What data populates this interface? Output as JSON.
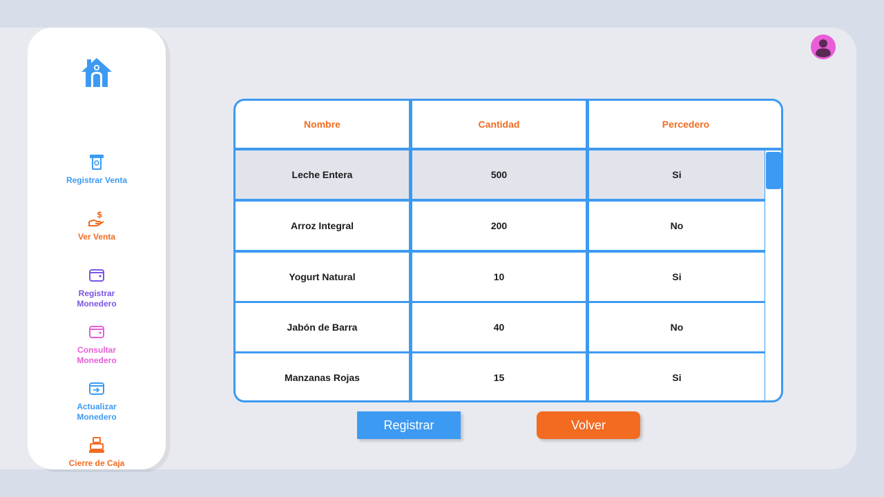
{
  "sidebar": {
    "items": [
      {
        "label": "Registrar Venta",
        "icon": "atm-cash-icon",
        "color": "#3d9af2"
      },
      {
        "label": "Ver Venta",
        "icon": "hand-money-icon",
        "color": "#f26b21"
      },
      {
        "label": "Registrar\nMonedero",
        "icon": "wallet-icon",
        "color": "#7b55e3"
      },
      {
        "label": "Consultar\nMonedero",
        "icon": "wallet-icon",
        "color": "#e85ed8"
      },
      {
        "label": "Actualizar\nMonedero",
        "icon": "wallet-transfer-icon",
        "color": "#3d9af2"
      },
      {
        "label": "Cierre de Caja",
        "icon": "cash-register-icon",
        "color": "#f26b21"
      }
    ]
  },
  "table": {
    "columns": [
      "Nombre",
      "Cantidad",
      "Percedero"
    ],
    "rows": [
      [
        "Leche Entera",
        "500",
        "Si"
      ],
      [
        "Arroz Integral",
        "200",
        "No"
      ],
      [
        "Yogurt Natural",
        "10",
        "Si"
      ],
      [
        "Jabón de Barra",
        "40",
        "No"
      ],
      [
        "Manzanas Rojas",
        "15",
        "Si"
      ]
    ],
    "selected_row": 0
  },
  "buttons": {
    "register": "Registrar",
    "back": "Volver"
  },
  "colors": {
    "accent_blue": "#3d9af2",
    "accent_orange": "#f26b21",
    "avatar": "#e85ed8"
  }
}
